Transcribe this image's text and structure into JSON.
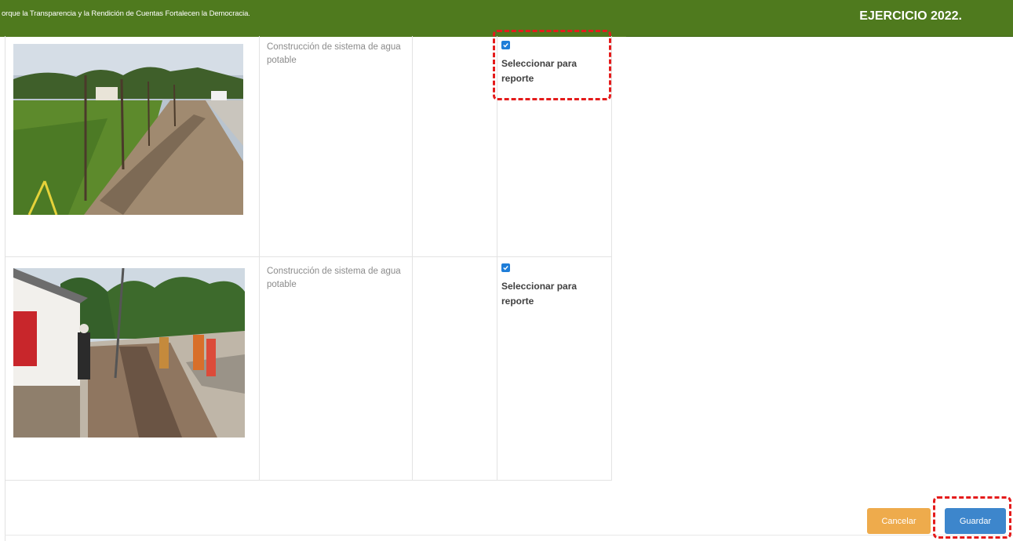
{
  "header": {
    "slogan": "orque la Transparencia y la Rendición de Cuentas Fortalecen la Democracia.",
    "year_label": "EJERCICIO 2022."
  },
  "rows": [
    {
      "photo_icon": "construction-photo",
      "description": "Construcción de sistema de agua potable",
      "checked": true,
      "select_label": "Seleccionar para reporte"
    },
    {
      "photo_icon": "construction-photo",
      "description": "Construcción de sistema de agua potable",
      "checked": true,
      "select_label": "Seleccionar para reporte"
    }
  ],
  "actions": {
    "cancel_label": "Cancelar",
    "save_label": "Guardar"
  },
  "colors": {
    "header_bg": "#4f7a1e",
    "checkbox": "#1e7dd8",
    "cancel_button": "#eeab4c",
    "save_button": "#3d86cc",
    "highlight": "#e41b1b"
  }
}
